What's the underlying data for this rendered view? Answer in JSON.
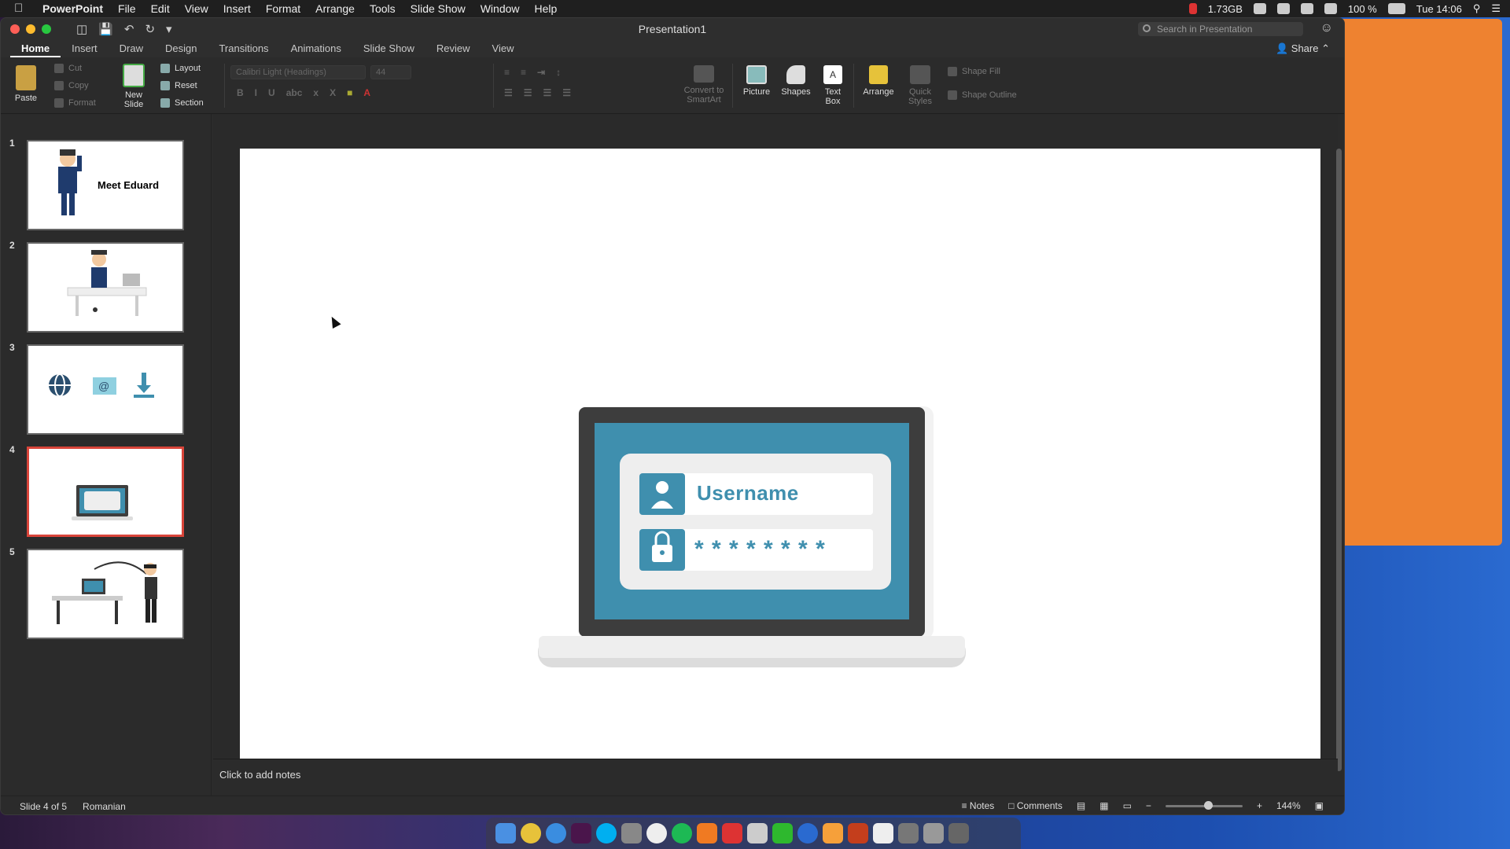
{
  "menubar": {
    "app_name": "PowerPoint",
    "items": [
      "File",
      "Edit",
      "View",
      "Insert",
      "Format",
      "Arrange",
      "Tools",
      "Slide Show",
      "Window",
      "Help"
    ],
    "memory": "1.73GB",
    "battery": "100 %",
    "clock": "Tue 14:06"
  },
  "window": {
    "title": "Presentation1",
    "search_placeholder": "Search in Presentation",
    "share_label": "Share",
    "tabs": [
      {
        "label": "Home",
        "active": true
      },
      {
        "label": "Insert"
      },
      {
        "label": "Draw"
      },
      {
        "label": "Design"
      },
      {
        "label": "Transitions"
      },
      {
        "label": "Animations"
      },
      {
        "label": "Slide Show"
      },
      {
        "label": "Review"
      },
      {
        "label": "View"
      }
    ]
  },
  "ribbon": {
    "paste": "Paste",
    "cut": "Cut",
    "copy": "Copy",
    "format": "Format",
    "new_slide": "New Slide",
    "layout": "Layout",
    "reset": "Reset",
    "section": "Section",
    "font_name": "Calibri Light (Headings)",
    "font_size": "44",
    "convert_smartart": "Convert to SmartArt",
    "picture": "Picture",
    "shapes": "Shapes",
    "text_box": "Text Box",
    "arrange": "Arrange",
    "quick_styles": "Quick Styles",
    "shape_fill": "Shape Fill",
    "shape_outline": "Shape Outline"
  },
  "slides": [
    {
      "num": "1",
      "caption": "Meet Eduard"
    },
    {
      "num": "2"
    },
    {
      "num": "3"
    },
    {
      "num": "4",
      "selected": true
    },
    {
      "num": "5"
    }
  ],
  "slide_main": {
    "username_label": "Username",
    "password_mask": "* * * * * * * *"
  },
  "notes": {
    "placeholder": "Click to add notes"
  },
  "status": {
    "slide_position": "Slide 4 of 5",
    "language": "Romanian",
    "notes": "Notes",
    "comments": "Comments",
    "zoom": "144%",
    "zoom_fraction": 0.55
  },
  "colors": {
    "accent_teal": "#3f8fae",
    "laptop_frame": "#3d3d3d",
    "selection_red": "#d9453a",
    "orange_window": "#ee8230"
  }
}
